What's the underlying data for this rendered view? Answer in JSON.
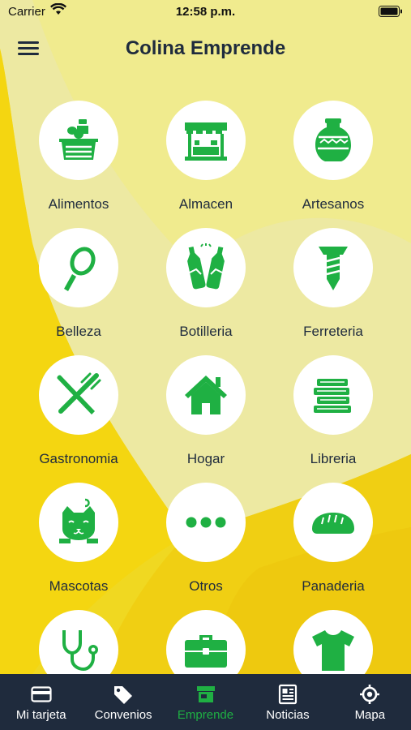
{
  "status_bar": {
    "carrier": "Carrier",
    "time": "12:58 p.m."
  },
  "header": {
    "title": "Colina Emprende"
  },
  "colors": {
    "accent": "#1fb043",
    "background_yellow": "#f3dd2a",
    "tabbar": "#1f2b3d",
    "text": "#1f2b3d"
  },
  "categories": [
    {
      "label": "Alimentos",
      "icon": "grocery-basket-icon"
    },
    {
      "label": "Almacen",
      "icon": "storefront-icon"
    },
    {
      "label": "Artesanos",
      "icon": "vase-icon"
    },
    {
      "label": "Belleza",
      "icon": "hand-mirror-icon"
    },
    {
      "label": "Botilleria",
      "icon": "beer-bottles-icon"
    },
    {
      "label": "Ferreteria",
      "icon": "screw-icon"
    },
    {
      "label": "Gastronomia",
      "icon": "fork-knife-icon"
    },
    {
      "label": "Hogar",
      "icon": "house-icon"
    },
    {
      "label": "Libreria",
      "icon": "books-icon"
    },
    {
      "label": "Mascotas",
      "icon": "cat-icon"
    },
    {
      "label": "Otros",
      "icon": "ellipsis-icon"
    },
    {
      "label": "Panaderia",
      "icon": "bread-icon"
    },
    {
      "label": "",
      "icon": "stethoscope-icon"
    },
    {
      "label": "",
      "icon": "briefcase-icon"
    },
    {
      "label": "",
      "icon": "tshirt-icon"
    }
  ],
  "tabbar": {
    "active": "Emprende",
    "tabs": [
      {
        "label": "Mi tarjeta",
        "icon": "card-icon"
      },
      {
        "label": "Convenios",
        "icon": "tag-icon"
      },
      {
        "label": "Emprende",
        "icon": "store-icon"
      },
      {
        "label": "Noticias",
        "icon": "newspaper-icon"
      },
      {
        "label": "Mapa",
        "icon": "location-icon"
      }
    ]
  }
}
